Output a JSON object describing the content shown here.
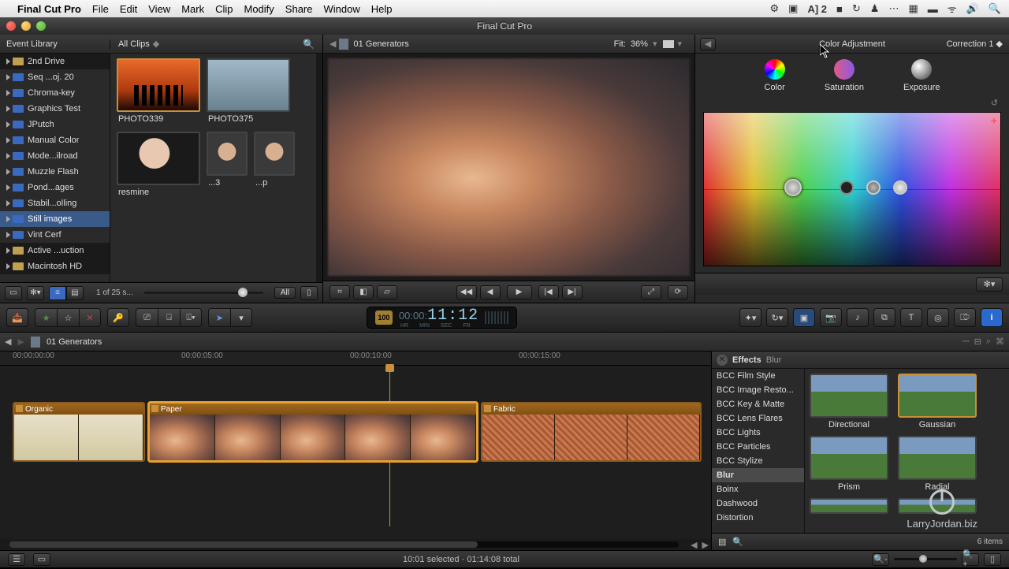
{
  "menubar": {
    "app": "Final Cut Pro",
    "items": [
      "File",
      "Edit",
      "View",
      "Mark",
      "Clip",
      "Modify",
      "Share",
      "Window",
      "Help"
    ],
    "right_badge": "2"
  },
  "window": {
    "title": "Final Cut Pro"
  },
  "library": {
    "title": "Event Library",
    "clips_filter": "All Clips",
    "tree": [
      {
        "label": "2nd Drive",
        "kind": "drive"
      },
      {
        "label": "Seq ...oj. 20",
        "kind": "event"
      },
      {
        "label": "Chroma-key",
        "kind": "event"
      },
      {
        "label": "Graphics Test",
        "kind": "event"
      },
      {
        "label": "JPutch",
        "kind": "event"
      },
      {
        "label": "Manual Color",
        "kind": "event"
      },
      {
        "label": "Mode...ilroad",
        "kind": "event"
      },
      {
        "label": "Muzzle Flash",
        "kind": "event"
      },
      {
        "label": "Pond...ages",
        "kind": "event"
      },
      {
        "label": "Stabil...olling",
        "kind": "event"
      },
      {
        "label": "Still images",
        "kind": "event",
        "selected": true
      },
      {
        "label": "Vint Cerf",
        "kind": "event"
      },
      {
        "label": "Active ...uction",
        "kind": "drive"
      },
      {
        "label": "Macintosh HD",
        "kind": "drive"
      }
    ],
    "thumbs": [
      {
        "label": "PHOTO339",
        "cls": "sunset",
        "selected": true
      },
      {
        "label": "PHOTO375",
        "cls": "city"
      },
      {
        "label": "resmine",
        "cls": "face1"
      },
      {
        "label": "...3",
        "cls": "face2",
        "small": true
      },
      {
        "label": "...p",
        "cls": "face2",
        "small": true
      }
    ],
    "footer_count": "1 of 25 s...",
    "footer_all": "All"
  },
  "viewer": {
    "title": "01 Generators",
    "fit_label": "Fit:",
    "zoom": "36%"
  },
  "color_panel": {
    "title": "Color Adjustment",
    "correction": "Correction 1",
    "tabs": {
      "color": "Color",
      "saturation": "Saturation",
      "exposure": "Exposure"
    }
  },
  "toolbar": {
    "tc_badge": "100",
    "tc_prefix": "00:00:",
    "tc_main": "11:12",
    "tc_units": [
      "HR",
      "MIN",
      "SEC",
      "FR"
    ]
  },
  "timeline": {
    "project": "01 Generators",
    "ruler": [
      "00:00:00:00",
      "00:00:05:00",
      "00:00:10:00",
      "00:00:15:00"
    ],
    "clips": [
      {
        "name": "Organic"
      },
      {
        "name": "Paper",
        "selected": true
      },
      {
        "name": "Fabric"
      }
    ]
  },
  "effects": {
    "title": "Effects",
    "crumb": "Blur",
    "categories": [
      "BCC Film Style",
      "BCC Image Resto...",
      "BCC Key & Matte",
      "BCC Lens Flares",
      "BCC Lights",
      "BCC Particles",
      "BCC Stylize",
      "Blur",
      "Boinx",
      "Dashwood",
      "Distortion"
    ],
    "selected_category": "Blur",
    "presets": [
      "Directional",
      "Gaussian",
      "Prism",
      "Radial"
    ],
    "selected_preset": "Gaussian",
    "count": "6 items"
  },
  "watermark": "LarryJordan.biz",
  "status": {
    "center": "10:01 selected · 01:14:08 total"
  }
}
